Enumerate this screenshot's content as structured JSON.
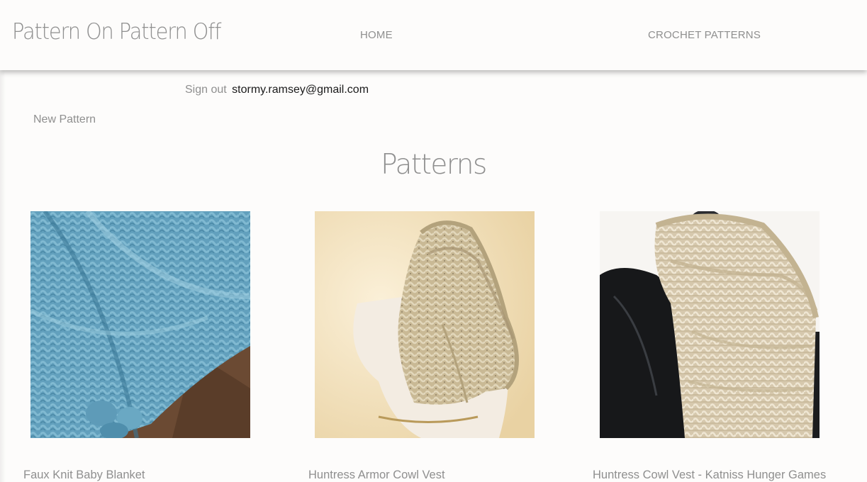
{
  "header": {
    "brand": "Pattern On Pattern Off",
    "nav": [
      "HOME",
      "CROCHET PATTERNS"
    ]
  },
  "account": {
    "signout_label": "Sign out",
    "email": "stormy.ramsey@gmail.com"
  },
  "actions": {
    "new_pattern": "New Pattern"
  },
  "main": {
    "title": "Patterns",
    "patterns": [
      {
        "title": "Faux Knit Baby Blanket"
      },
      {
        "title": "Huntress Armor Cowl Vest"
      },
      {
        "title": "Huntress Cowl Vest - Katniss Hunger Games"
      }
    ]
  }
}
